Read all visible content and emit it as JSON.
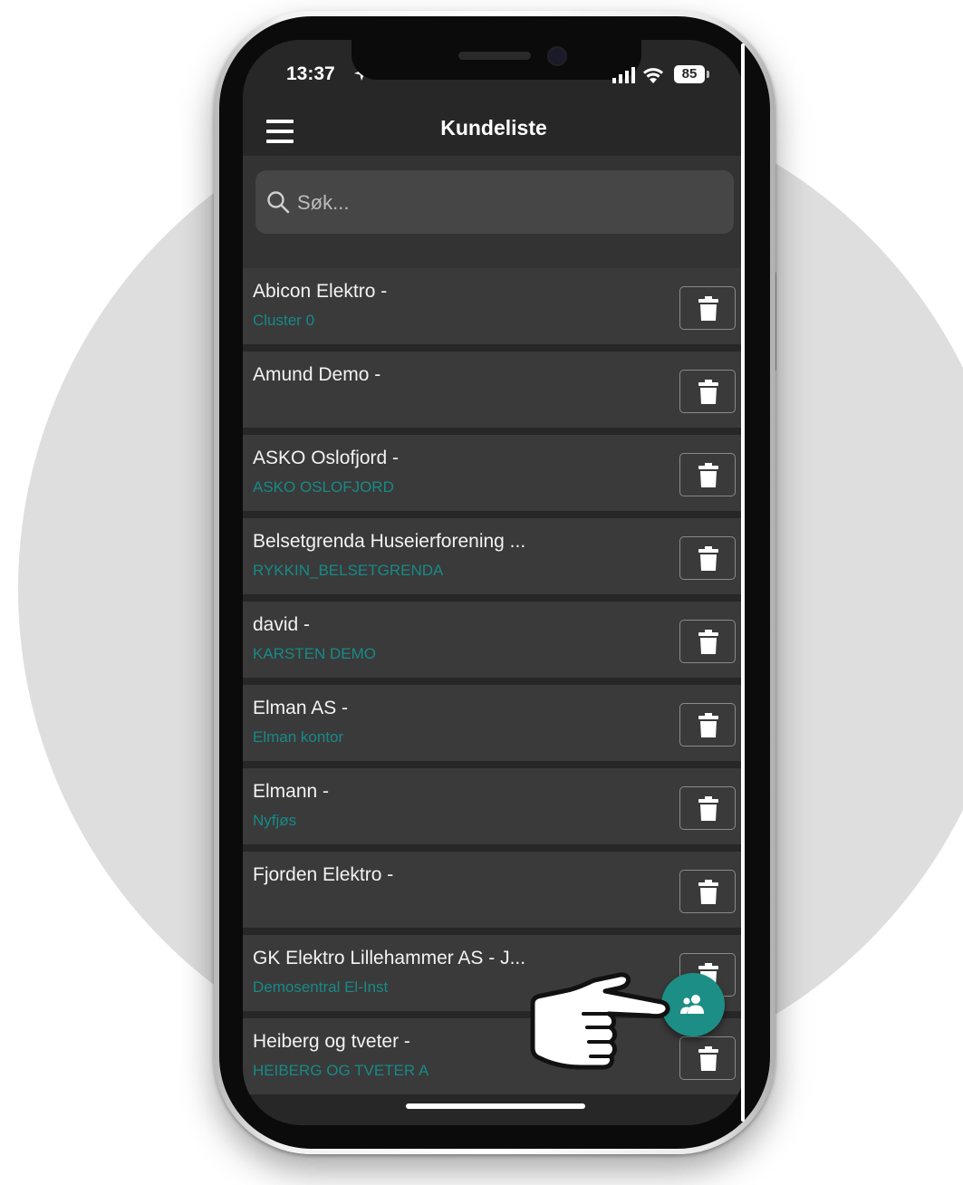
{
  "status_bar": {
    "time": "13:37",
    "battery": "85"
  },
  "header": {
    "title": "Kundeliste"
  },
  "search": {
    "placeholder": "Søk..."
  },
  "customers": [
    {
      "name": "Abicon Elektro -",
      "sub": "Cluster 0"
    },
    {
      "name": "Amund Demo -",
      "sub": ""
    },
    {
      "name": "ASKO Oslofjord -",
      "sub": "ASKO OSLOFJORD"
    },
    {
      "name": "Belsetgrenda Huseierforening ...",
      "sub": "RYKKIN_BELSETGRENDA"
    },
    {
      "name": "david -",
      "sub": "KARSTEN DEMO"
    },
    {
      "name": "Elman AS -",
      "sub": "Elman kontor"
    },
    {
      "name": "Elmann -",
      "sub": "Nyfjøs"
    },
    {
      "name": "Fjorden Elektro -",
      "sub": ""
    },
    {
      "name": "GK Elektro Lillehammer AS - J...",
      "sub": "Demosentral El-Inst"
    },
    {
      "name": "Heiberg og tveter -",
      "sub": "HEIBERG OG TVETER A"
    }
  ],
  "icons": {
    "menu": "hamburger-menu-icon",
    "search": "search-icon",
    "delete": "trash-icon",
    "fab": "people-add-icon",
    "pointer": "pointing-hand-icon"
  },
  "colors": {
    "accent": "#1d8e86",
    "subtitle": "#178a87",
    "row_bg": "#3a3a3a",
    "screen_bg": "#272727"
  }
}
